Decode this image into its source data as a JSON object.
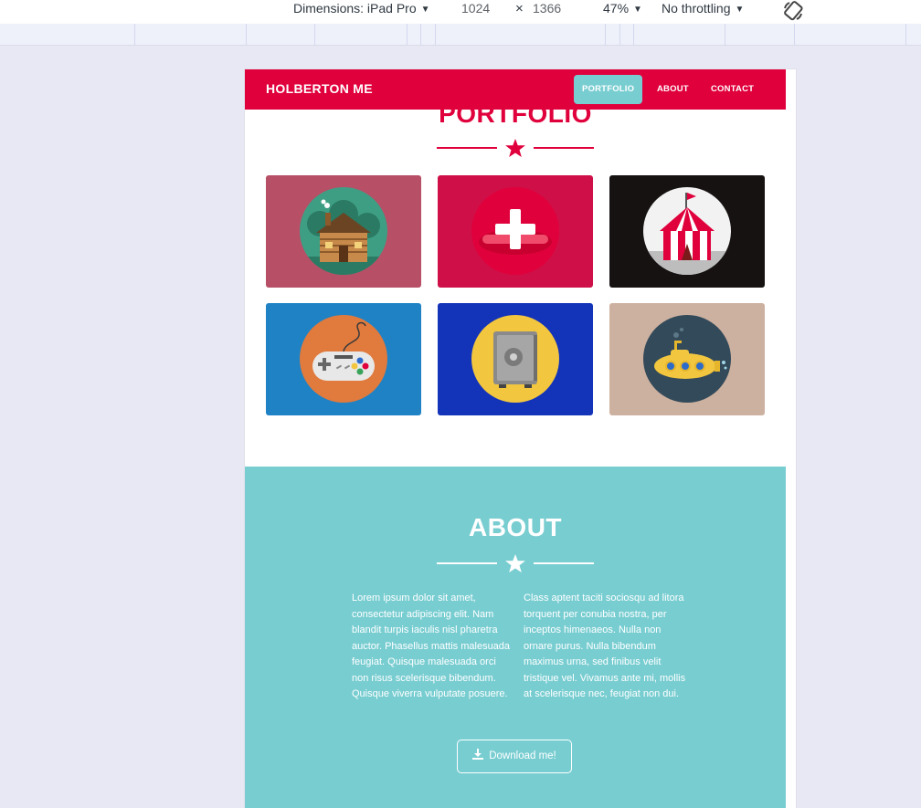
{
  "devtools": {
    "device_label": "Dimensions: iPad Pro",
    "width": "1024",
    "times": "×",
    "height": "1366",
    "zoom": "47%",
    "throttle": "No throttling"
  },
  "navbar": {
    "brand": "HOLBERTON ME",
    "links": [
      {
        "label": "PORTFOLIO",
        "active": true
      },
      {
        "label": "ABOUT",
        "active": false
      },
      {
        "label": "CONTACT",
        "active": false
      }
    ]
  },
  "portfolio": {
    "title": "PORTFOLIO",
    "items": [
      {
        "icon": "cabin-icon",
        "bg": "#b74f66",
        "circle": "#3e9e84"
      },
      {
        "icon": "cake-plus-icon",
        "bg": "#cf1048",
        "circle": "#e0003c"
      },
      {
        "icon": "circus-tent-icon",
        "bg": "#171212",
        "circle": "#f2f2f2"
      },
      {
        "icon": "game-controller-icon",
        "bg": "#1f82c5",
        "circle": "#e07a3d"
      },
      {
        "icon": "safe-icon",
        "bg": "#1333b8",
        "circle": "#f2c63f"
      },
      {
        "icon": "submarine-icon",
        "bg": "#cdb1a0",
        "circle": "#334a5a"
      }
    ]
  },
  "about": {
    "title": "ABOUT",
    "col1": "Lorem ipsum dolor sit amet, consectetur adipiscing elit. Nam blandit turpis iaculis nisl pharetra auctor. Phasellus mattis malesuada feugiat. Quisque malesuada orci non risus scelerisque bibendum. Quisque viverra vulputate posuere.",
    "col2": "Class aptent taciti sociosqu ad litora torquent per conubia nostra, per inceptos himenaeos. Nulla non ornare purus. Nulla bibendum maximus urna, sed finibus velit tristique vel. Vivamus ante mi, mollis at scelerisque nec, feugiat non dui.",
    "download": "Download me!"
  },
  "colors": {
    "primary": "#e0003c",
    "accent": "#78cdd1"
  }
}
